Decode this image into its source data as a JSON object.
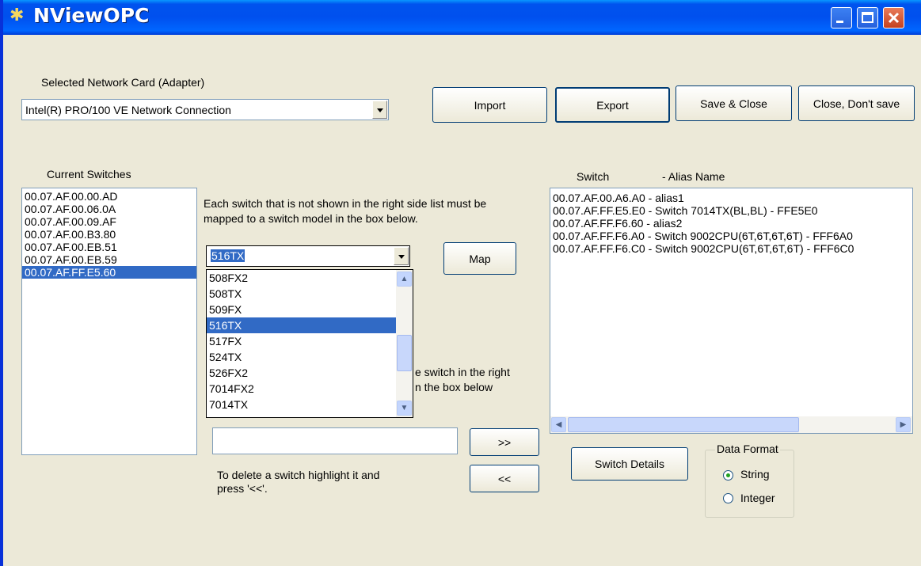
{
  "window": {
    "title": "NViewOPC"
  },
  "adapter": {
    "label": "Selected Network Card (Adapter)",
    "selected": "Intel(R) PRO/100 VE Network Connection"
  },
  "toolbar": {
    "import_label": "Import",
    "export_label": "Export",
    "save_close_label": "Save & Close",
    "close_nosave_label": "Close, Don't save"
  },
  "current_switches": {
    "label": "Current Switches",
    "items": [
      "00.07.AF.00.00.AD",
      "00.07.AF.00.06.0A",
      "00.07.AF.00.09.AF",
      "00.07.AF.00.B3.80",
      "00.07.AF.00.EB.51",
      "00.07.AF.00.EB.59",
      "00.07.AF.FF.E5.60"
    ],
    "selected_index": 6
  },
  "mapping": {
    "instruction": "Each switch that is not shown in the right side list must be\nmapped to a switch model in the box below.",
    "model_selected": "516TX",
    "map_label": "Map",
    "dropdown_items": [
      "508FX2",
      "508TX",
      "509FX",
      "516TX",
      "517FX",
      "524TX",
      "526FX2",
      "7014FX2",
      "7014TX"
    ],
    "dropdown_selected_index": 3
  },
  "alias": {
    "instruction_fragment_1": "e switch in the right",
    "instruction_fragment_2": "n the box below",
    "input_value": "",
    "add_label": ">>",
    "remove_label": "<<",
    "delete_hint": "To delete a switch highlight it and\npress '<<'."
  },
  "switch_list": {
    "header_switch": "Switch",
    "header_alias": "- Alias Name",
    "rows": [
      "00.07.AF.00.A6.A0  -  alias1",
      "00.07.AF.FF.E5.E0  -  Switch 7014TX(BL,BL) - FFE5E0",
      "00.07.AF.FF.F6.60  -  alias2",
      "00.07.AF.FF.F6.A0  -  Switch 9002CPU(6T,6T,6T,6T) - FFF6A0",
      "00.07.AF.FF.F6.C0  -  Switch 9002CPU(6T,6T,6T,6T) - FFF6C0"
    ]
  },
  "details": {
    "switch_details_label": "Switch Details"
  },
  "data_format": {
    "legend": "Data Format",
    "options": [
      "String",
      "Integer"
    ],
    "selected": "String"
  },
  "colors": {
    "title_bar": "#0054e3",
    "selection": "#316ac5",
    "dialog_bg": "#ece9d8"
  }
}
